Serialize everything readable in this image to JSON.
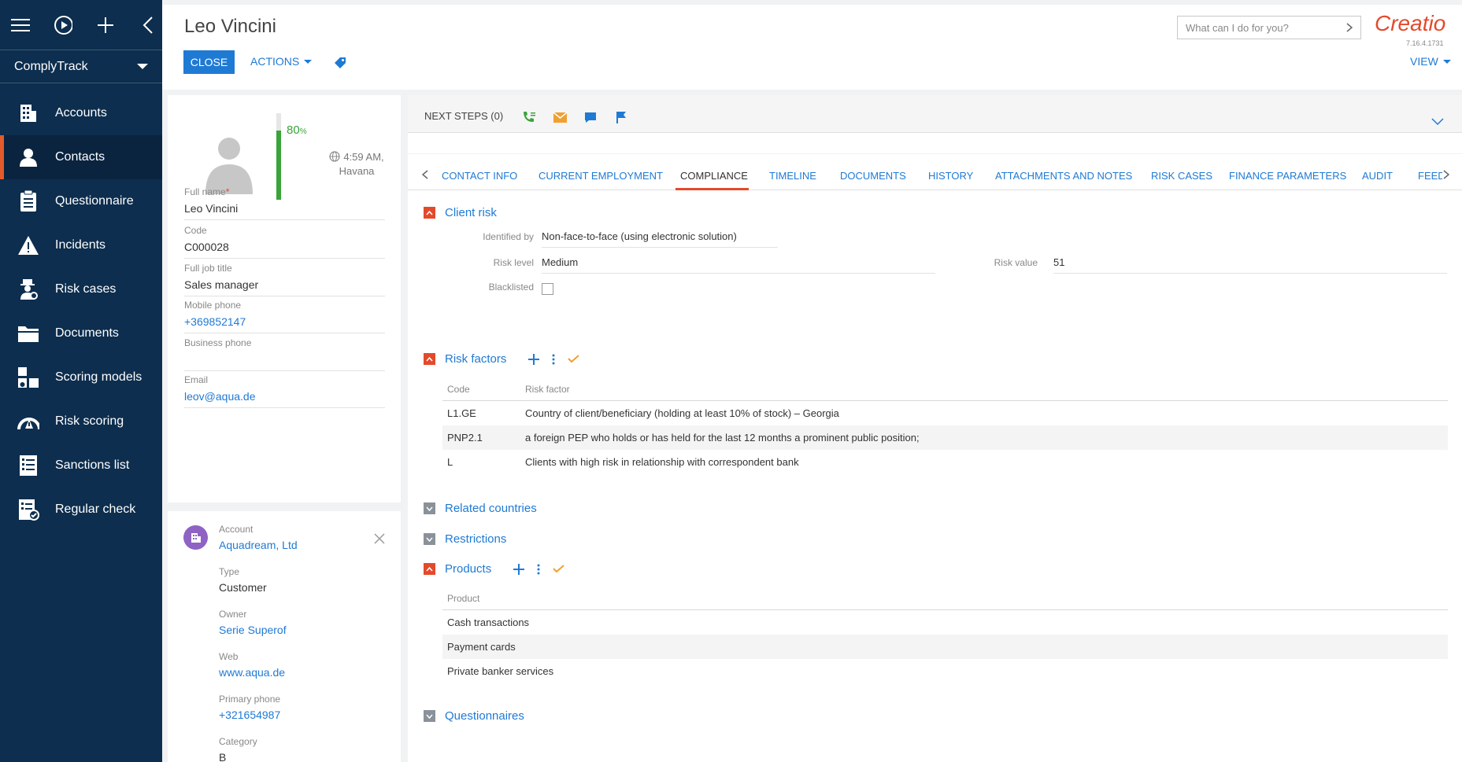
{
  "sidebar": {
    "app_name": "ComplyTrack",
    "items": [
      {
        "label": "Accounts",
        "icon": "building-icon"
      },
      {
        "label": "Contacts",
        "icon": "person-icon"
      },
      {
        "label": "Questionnaire",
        "icon": "clipboard-icon"
      },
      {
        "label": "Incidents",
        "icon": "warning-icon"
      },
      {
        "label": "Risk cases",
        "icon": "detective-icon"
      },
      {
        "label": "Documents",
        "icon": "folder-icon"
      },
      {
        "label": "Scoring models",
        "icon": "scoring-icon"
      },
      {
        "label": "Risk scoring",
        "icon": "gauge-icon"
      },
      {
        "label": "Sanctions list",
        "icon": "list-icon"
      },
      {
        "label": "Regular check",
        "icon": "check-list-icon"
      }
    ],
    "active_index": 1
  },
  "header": {
    "title": "Leo Vincini",
    "close_label": "CLOSE",
    "actions_label": "ACTIONS",
    "search_placeholder": "What can I do for you?",
    "logo": "Creatio",
    "version": "7.16.4.1731",
    "view_label": "VIEW"
  },
  "profile": {
    "completeness": 80,
    "completeness_label": "80",
    "completeness_unit": "%",
    "time": "4:59 AM,",
    "city": "Havana",
    "fields": {
      "full_name": {
        "label": "Full name",
        "required_mark": "*",
        "value": "Leo Vincini"
      },
      "code": {
        "label": "Code",
        "value": "C000028"
      },
      "job_title": {
        "label": "Full job title",
        "value": "Sales manager"
      },
      "mobile_phone": {
        "label": "Mobile phone",
        "value": "+369852147"
      },
      "business_phone": {
        "label": "Business phone",
        "value": ""
      },
      "email": {
        "label": "Email",
        "value": "leov@aqua.de"
      }
    }
  },
  "account_card": {
    "account_label": "Account",
    "account_value": "Aquadream, Ltd",
    "type_label": "Type",
    "type_value": "Customer",
    "owner_label": "Owner",
    "owner_value": "Serie Superof",
    "web_label": "Web",
    "web_value": "www.aqua.de",
    "phone_label": "Primary phone",
    "phone_value": "+321654987",
    "category_label": "Category",
    "category_value": "B"
  },
  "next_steps": {
    "label": "NEXT STEPS (0)"
  },
  "tabs": [
    {
      "label": "CONTACT INFO"
    },
    {
      "label": "CURRENT EMPLOYMENT"
    },
    {
      "label": "COMPLIANCE"
    },
    {
      "label": "TIMELINE"
    },
    {
      "label": "DOCUMENTS"
    },
    {
      "label": "HISTORY"
    },
    {
      "label": "ATTACHMENTS AND NOTES"
    },
    {
      "label": "RISK CASES"
    },
    {
      "label": "FINANCE PARAMETERS"
    },
    {
      "label": "AUDIT"
    },
    {
      "label": "FEED"
    }
  ],
  "active_tab": "COMPLIANCE",
  "client_risk": {
    "title": "Client risk",
    "identified_by_label": "Identified by",
    "identified_by_value": "Non-face-to-face (using electronic solution)",
    "risk_level_label": "Risk level",
    "risk_level_value": "Medium",
    "risk_value_label": "Risk value",
    "risk_value_value": "51",
    "blacklisted_label": "Blacklisted",
    "blacklisted": false
  },
  "risk_factors": {
    "title": "Risk factors",
    "columns": [
      "Code",
      "Risk factor"
    ],
    "rows": [
      {
        "code": "L1.GE",
        "factor": "Country of client/beneficiary (holding at least 10% of stock) – Georgia"
      },
      {
        "code": "PNP2.1",
        "factor": "a foreign PEP who holds or has held for the last 12 months a prominent public position;"
      },
      {
        "code": "L",
        "factor": "Clients with high risk in relationship with correspondent bank"
      }
    ]
  },
  "related_countries": {
    "title": "Related countries"
  },
  "restrictions": {
    "title": "Restrictions"
  },
  "products": {
    "title": "Products",
    "column": "Product",
    "rows": [
      "Cash transactions",
      "Payment cards",
      "Private banker services"
    ]
  },
  "questionnaires": {
    "title": "Questionnaires"
  }
}
